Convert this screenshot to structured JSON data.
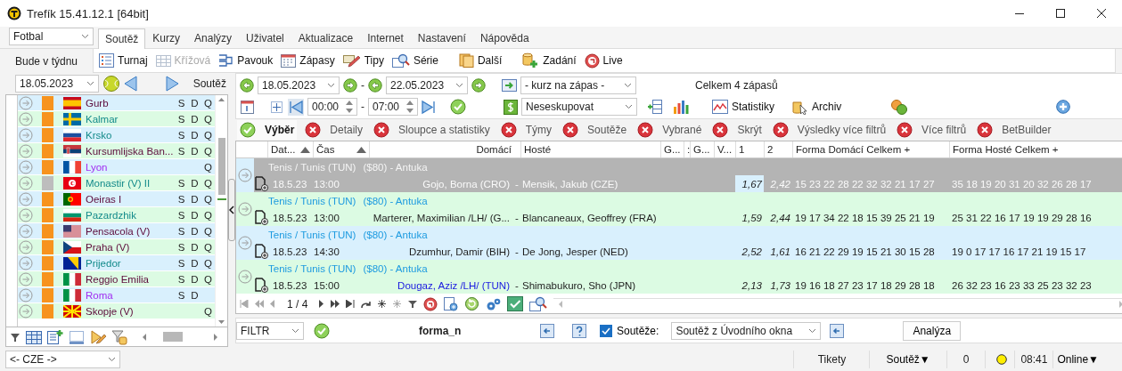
{
  "window": {
    "title": "Trefík 15.41.12.1 [64bit]"
  },
  "sport_select": {
    "value": "Fotbal"
  },
  "tabs": [
    {
      "label": "Soutěž",
      "selected": true
    },
    {
      "label": "Kurzy",
      "selected": false
    },
    {
      "label": "Analýzy",
      "selected": false
    },
    {
      "label": "Uživatel",
      "selected": false
    },
    {
      "label": "Aktualizace",
      "selected": false
    },
    {
      "label": "Internet",
      "selected": false
    },
    {
      "label": "Nastavení",
      "selected": false
    },
    {
      "label": "Nápověda",
      "selected": false
    }
  ],
  "period_label": "Bude v týdnu",
  "toolbar": [
    {
      "label": "Turnaj",
      "disabled": false
    },
    {
      "label": "Křížová",
      "disabled": true
    },
    {
      "label": "Pavouk",
      "disabled": false
    },
    {
      "label": "Zápasy",
      "disabled": false
    },
    {
      "label": "Tipy",
      "disabled": false
    },
    {
      "label": "Série",
      "disabled": false
    },
    {
      "label": "Další",
      "disabled": false
    },
    {
      "label": "Zadání",
      "disabled": false
    },
    {
      "label": "Live",
      "disabled": false
    }
  ],
  "left_panel": {
    "date": "18.05.2023",
    "label": "Soutěž",
    "competitions": [
      {
        "name": "Gurb",
        "color": "#5c0a3a",
        "enabled": true,
        "s": "S",
        "d": "D",
        "q": "Q"
      },
      {
        "name": "Kalmar",
        "color": "#138a8a",
        "enabled": true,
        "s": "S",
        "d": "D",
        "q": "Q"
      },
      {
        "name": "Krsko",
        "color": "#138a8a",
        "enabled": true,
        "s": "S",
        "d": "D",
        "q": "Q"
      },
      {
        "name": "Kursumlijska Ban...",
        "color": "#5c0a3a",
        "enabled": true,
        "s": "S",
        "d": "D",
        "q": "Q"
      },
      {
        "name": "Lyon",
        "color": "#a12cf0",
        "enabled": true,
        "q": "Q"
      },
      {
        "name": "Monastir (V) II",
        "color": "#138a8a",
        "enabled": false,
        "s": "S",
        "d": "D",
        "q": "Q"
      },
      {
        "name": "Oeiras I",
        "color": "#5c0a3a",
        "enabled": true,
        "s": "S",
        "d": "D",
        "q": "Q"
      },
      {
        "name": "Pazardzhik",
        "color": "#138a8a",
        "enabled": true,
        "s": "S",
        "d": "D",
        "q": "Q"
      },
      {
        "name": "Pensacola (V)",
        "color": "#5c0a3a",
        "enabled": true,
        "s": "S",
        "d": "D",
        "q": "Q"
      },
      {
        "name": "Praha (V)",
        "color": "#5c0a3a",
        "enabled": true,
        "s": "S",
        "d": "D",
        "q": "Q"
      },
      {
        "name": "Prijedor",
        "color": "#138a8a",
        "enabled": true,
        "s": "S",
        "d": "D",
        "q": "Q"
      },
      {
        "name": "Reggio Emilia",
        "color": "#5c0a3a",
        "enabled": true,
        "s": "S",
        "d": "D",
        "q": "Q"
      },
      {
        "name": "Roma",
        "color": "#a12cf0",
        "enabled": true,
        "s": "S",
        "d": "D"
      },
      {
        "name": "Skopje (V)",
        "color": "#5c0a3a",
        "enabled": true,
        "q": "Q"
      }
    ],
    "country_select": "<- CZE ->"
  },
  "filters": {
    "date_from": "18.05.2023",
    "date_to": "22.05.2023",
    "range_separator": "-",
    "odds_select": "- kurz na zápas -",
    "total": "Celkem 4 zápasů",
    "time_from": "00:00",
    "time_to": "07:00",
    "time_separator": "-",
    "group_select": "Neseskupovat",
    "buttons": [
      "Statistiky",
      "Archiv"
    ]
  },
  "chips": [
    {
      "label": "Výběr",
      "on": true
    },
    {
      "label": "Detaily",
      "on": false
    },
    {
      "label": "Sloupce a statistiky",
      "on": false
    },
    {
      "label": "Týmy",
      "on": false
    },
    {
      "label": "Soutěže",
      "on": false
    },
    {
      "label": "Vybrané",
      "on": false
    },
    {
      "label": "Skrýt",
      "on": false
    },
    {
      "label": "Výsledky více filtrů",
      "on": false
    },
    {
      "label": "Více filtrů",
      "on": false
    },
    {
      "label": "BetBuilder",
      "on": false
    }
  ],
  "table": {
    "columns": [
      {
        "label": "Dat...",
        "sorted": true
      },
      {
        "label": "Čas",
        "sorted": true
      },
      {
        "label": "Domácí",
        "sorted": false
      },
      {
        "label": "Hosté",
        "sorted": false
      },
      {
        "label": "G...",
        "sorted": false
      },
      {
        "label": ":",
        "sorted": false
      },
      {
        "label": "G...",
        "sorted": false
      },
      {
        "label": "V...",
        "sorted": false
      },
      {
        "label": "1",
        "sorted": false
      },
      {
        "label": "2",
        "sorted": false
      },
      {
        "label": "Forma Domácí Celkem +",
        "sorted": false
      },
      {
        "label": "Forma Hosté Celkem +",
        "sorted": false
      }
    ],
    "rows": [
      {
        "category": "Tenis / Tunis (TUN)",
        "tournament": "($80) - Antuka",
        "date": "18.5.23",
        "time": "13:00",
        "home": "Gojo, Borna (CRO)",
        "separator": "-",
        "away": "Mensik, Jakub (CZE)",
        "odds_1": "1,67",
        "odds_2": "2,42",
        "form_home": "15 23 22 28 22 32 32 21 17 27",
        "form_away": "35 18 19 20 31 20 32 26 28 17",
        "selected": true,
        "home_marked": false
      },
      {
        "category": "Tenis / Tunis (TUN)",
        "tournament": "($80) - Antuka",
        "date": "18.5.23",
        "time": "13:00",
        "home": "Marterer, Maximilian /LH/ (G...",
        "separator": "-",
        "away": "Blancaneaux, Geoffrey (FRA)",
        "odds_1": "1,59",
        "odds_2": "2,44",
        "form_home": "19 17 34 22 18 15 39 25 21 19",
        "form_away": "25 31 22 16 17 19 19 29 28 16",
        "selected": false,
        "home_marked": false
      },
      {
        "category": "Tenis / Tunis (TUN)",
        "tournament": "($80) - Antuka",
        "date": "18.5.23",
        "time": "14:30",
        "home": "Dzumhur, Damir (BIH)",
        "separator": "-",
        "away": "De Jong, Jesper (NED)",
        "odds_1": "2,52",
        "odds_2": "1,61",
        "form_home": "16 21 22 29 19 15 21 30 15 28",
        "form_away": "19 0 17 17 16 17 21 19 15 17",
        "selected": false,
        "home_marked": false
      },
      {
        "category": "Tenis / Tunis (TUN)",
        "tournament": "($80) - Antuka",
        "date": "18.5.23",
        "time": "15:00",
        "home": "Dougaz, Aziz /LH/ (TUN)",
        "separator": "-",
        "away": "Shimabukuro, Sho (JPN)",
        "odds_1": "2,13",
        "odds_2": "1,73",
        "form_home": "19 16 18 27 23 17 18 29 28 18",
        "form_away": "26 32 23 16 23 33 25 23 32 23",
        "selected": false,
        "home_marked": true
      }
    ],
    "pager": "1 / 4"
  },
  "filter_bar": {
    "filter_select": "FILTR",
    "filter_name": "forma_n",
    "competitions_checkbox": {
      "label": "Soutěže:",
      "checked": true
    },
    "competitions_select": "Soutěž z Úvodního okna",
    "button": "Analýza"
  },
  "status_bar": {
    "tickets": "Tikety",
    "competition_menu": "Soutěž▼",
    "count": "0",
    "time": "08:41",
    "online_menu": "Online▼"
  }
}
